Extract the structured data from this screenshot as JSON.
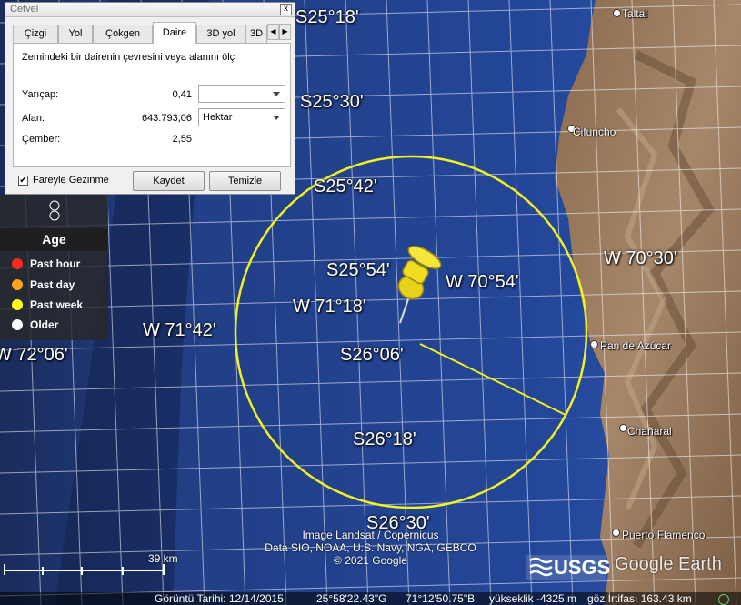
{
  "dialog": {
    "title": "Cetvel",
    "close_glyph": "x",
    "tabs": [
      "Çizgi",
      "Yol",
      "Çokgen",
      "Daire",
      "3D yol",
      "3D"
    ],
    "active_tab": "Daire",
    "description": "Zemindeki bir dairenin çevresini veya alanını ölç",
    "radius_label": "Yarıçap:",
    "radius_value": "0,41",
    "radius_unit": "",
    "area_label": "Alan:",
    "area_value": "643.793,06",
    "area_unit": "Hektar",
    "circumference_label": "Çember:",
    "circumference_value": "2,55",
    "mouse_nav_label": "Fareyle Gezinme",
    "mouse_nav_checked": "✔",
    "save_button": "Kaydet",
    "clear_button": "Temizle"
  },
  "legend": {
    "title": "Age",
    "items": [
      {
        "label": "Past hour",
        "color": "#ff2a1a"
      },
      {
        "label": "Past day",
        "color": "#ffa31a"
      },
      {
        "label": "Past week",
        "color": "#ffff1a"
      },
      {
        "label": "Older",
        "color": "#ffffff"
      }
    ]
  },
  "grid_labels": {
    "s2518": "S25°18'",
    "s2530": "S25°30'",
    "s2542": "S25°42'",
    "s2554": "S25°54'",
    "s2606": "S26°06'",
    "s2618": "S26°18'",
    "s2630": "S26°30'",
    "w7030": "W 70°30'",
    "w7054": "W 70°54'",
    "w7118": "W 71°18'",
    "w7142": "W 71°42'",
    "w7206": "W 72°06'"
  },
  "places": {
    "taltal": "Taltal",
    "cifuncho": "Cifuncho",
    "pan_de_azucar": "Pan de Azúcar",
    "chanaral": "Chañaral",
    "puerto_flamenco": "Puerto Flamenco"
  },
  "credits": {
    "line1": "Image Landsat / Copernicus",
    "line2": "Data SIO, NOAA, U.S. Navy, NGA, GEBCO",
    "line3": "© 2021 Google",
    "usgs": "USGS",
    "google_earth": "Google Earth"
  },
  "scale": "39 km",
  "status": {
    "image_date": "Görüntü Tarihi: 12/14/2015",
    "lat": "25°58'22.43\"G",
    "lon": "71°12'50.75\"B",
    "elevation": "yükseklik -4325 m",
    "eye_alt": "göz İrtifası 163.43 km"
  },
  "colors": {
    "ocean": "#1e3f8a",
    "land": "#9a7a5c",
    "circle": "#f2f21e"
  }
}
